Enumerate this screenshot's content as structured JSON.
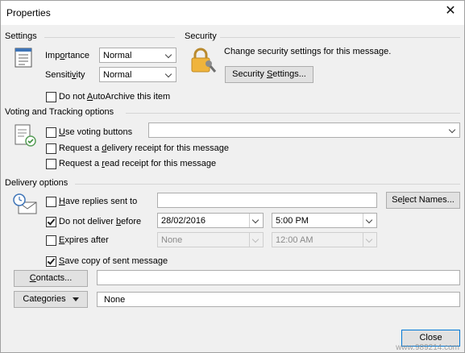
{
  "window": {
    "title": "Properties",
    "close_glyph": "✕"
  },
  "settings": {
    "heading": "Settings",
    "importance_label_pre": "Imp",
    "importance_label_u": "o",
    "importance_label_post": "rtance",
    "importance_value": "Normal",
    "sensitivity_label_pre": "Sensiti",
    "sensitivity_label_u": "v",
    "sensitivity_label_post": "ity",
    "sensitivity_value": "Normal",
    "autoarchive_pre": "Do not ",
    "autoarchive_u": "A",
    "autoarchive_post": "utoArchive this item"
  },
  "security": {
    "heading": "Security",
    "description": "Change security settings for this message.",
    "button_pre": "Security ",
    "button_u": "S",
    "button_post": "ettings..."
  },
  "voting": {
    "heading": "Voting and Tracking options",
    "use_voting_pre": "",
    "use_voting_u": "U",
    "use_voting_post": "se voting buttons",
    "delivery_receipt_pre": "Request a ",
    "delivery_receipt_u": "d",
    "delivery_receipt_post": "elivery receipt for this message",
    "read_receipt_pre": "Request a ",
    "read_receipt_u": "r",
    "read_receipt_post": "ead receipt for this message"
  },
  "delivery": {
    "heading": "Delivery options",
    "replies_pre": "",
    "replies_u": "H",
    "replies_post": "ave replies sent to",
    "select_names_pre": "Se",
    "select_names_u": "l",
    "select_names_post": "ect Names...",
    "do_not_deliver_pre": "Do not deliver ",
    "do_not_deliver_u": "b",
    "do_not_deliver_post": "efore",
    "do_not_deliver_date": "28/02/2016",
    "do_not_deliver_time": "5:00 PM",
    "expires_pre": "",
    "expires_u": "E",
    "expires_post": "xpires after",
    "expires_date": "None",
    "expires_time": "12:00 AM",
    "save_copy_pre": "",
    "save_copy_u": "S",
    "save_copy_post": "ave copy of sent message",
    "contacts_pre": "",
    "contacts_u": "C",
    "contacts_post": "ontacts...",
    "categories_label": "Categories",
    "categories_value": "None"
  },
  "footer": {
    "close_button": "Close"
  },
  "watermark": "www.989214.com"
}
